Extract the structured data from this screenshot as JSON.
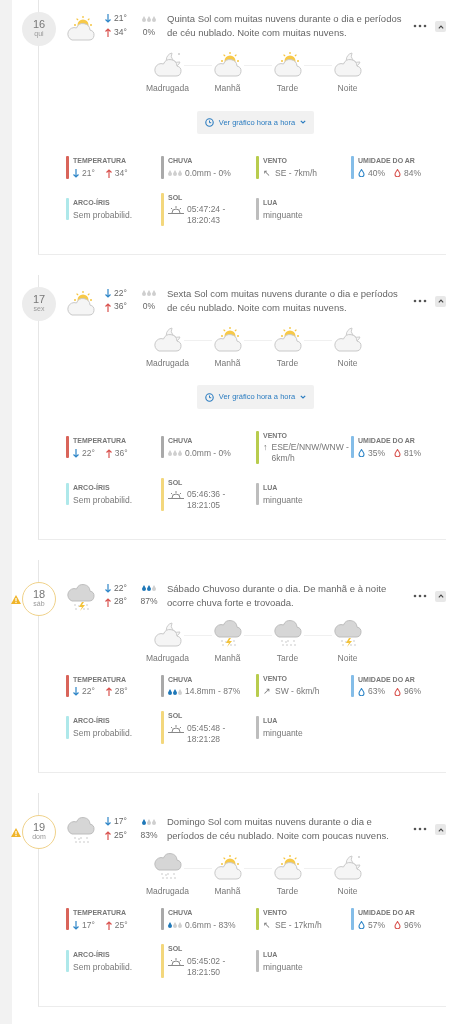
{
  "days": [
    {
      "alert": false,
      "day": "16",
      "weekday": "qui",
      "kind": "sun-cloud",
      "min": "21°",
      "max": "34°",
      "drops": [
        {
          "filled": false
        },
        {
          "filled": false
        },
        {
          "filled": false
        }
      ],
      "rain": "0%",
      "description": "Quinta Sol com muitas nuvens durante o dia e períodos de céu nublado. Noite com muitas nuvens.",
      "periods": [
        {
          "label": "Madrugada",
          "kind": "night-star"
        },
        {
          "label": "Manhã",
          "kind": "sun-cloud"
        },
        {
          "label": "Tarde",
          "kind": "sun-cloud"
        },
        {
          "label": "Noite",
          "kind": "night"
        }
      ],
      "graph_button": "Ver gráfico hora a hora",
      "stats": [
        {
          "kind": "temperature",
          "label": "TEMPERATURA",
          "color": "#d9645a",
          "min": "21°",
          "max": "34°"
        },
        {
          "kind": "rain",
          "label": "CHUVA",
          "color": "#a9a9a9",
          "drops": [
            {
              "filled": false
            },
            {
              "filled": false
            },
            {
              "filled": false
            }
          ],
          "value": "0.0mm - 0%"
        },
        {
          "kind": "wind",
          "label": "VENTO",
          "color": "#b8cc4e",
          "arrow": "↖",
          "value": "SE - 7km/h"
        },
        {
          "kind": "humidity",
          "label": "UMIDADE DO AR",
          "color": "#84bde8",
          "min": "40%",
          "max": "84%"
        },
        {
          "kind": "text",
          "label": "ARCO-ÍRIS",
          "color": "#aee8ea",
          "value": "Sem probabilid."
        },
        {
          "kind": "sun",
          "label": "SOL",
          "color": "#f3d77c",
          "value": "05:47:24 - 18:20:43"
        },
        {
          "kind": "text",
          "label": "LUA",
          "color": "#bdbdbd",
          "value": "minguante"
        }
      ]
    },
    {
      "alert": false,
      "day": "17",
      "weekday": "sex",
      "kind": "sun-cloud",
      "min": "22°",
      "max": "36°",
      "drops": [
        {
          "filled": false
        },
        {
          "filled": false
        },
        {
          "filled": false
        }
      ],
      "rain": "0%",
      "description": "Sexta Sol com muitas nuvens durante o dia e períodos de céu nublado. Noite com muitas nuvens.",
      "periods": [
        {
          "label": "Madrugada",
          "kind": "night"
        },
        {
          "label": "Manhã",
          "kind": "sun-cloud"
        },
        {
          "label": "Tarde",
          "kind": "sun-cloud"
        },
        {
          "label": "Noite",
          "kind": "night"
        }
      ],
      "graph_button": "Ver gráfico hora a hora",
      "stats": [
        {
          "kind": "temperature",
          "label": "TEMPERATURA",
          "color": "#d9645a",
          "min": "22°",
          "max": "36°"
        },
        {
          "kind": "rain",
          "label": "CHUVA",
          "color": "#a9a9a9",
          "drops": [
            {
              "filled": false
            },
            {
              "filled": false
            },
            {
              "filled": false
            }
          ],
          "value": "0.0mm - 0%"
        },
        {
          "kind": "wind",
          "label": "VENTO",
          "color": "#b8cc4e",
          "arrow": "↑",
          "value": "ESE/E/NNW/WNW - 6km/h"
        },
        {
          "kind": "humidity",
          "label": "UMIDADE DO AR",
          "color": "#84bde8",
          "min": "35%",
          "max": "81%"
        },
        {
          "kind": "text",
          "label": "ARCO-ÍRIS",
          "color": "#aee8ea",
          "value": "Sem probabilid."
        },
        {
          "kind": "sun",
          "label": "SOL",
          "color": "#f3d77c",
          "value": "05:46:36 - 18:21:05"
        },
        {
          "kind": "text",
          "label": "LUA",
          "color": "#bdbdbd",
          "value": "minguante"
        }
      ]
    },
    {
      "alert": true,
      "day": "18",
      "weekday": "sáb",
      "kind": "storm",
      "min": "22°",
      "max": "28°",
      "drops": [
        {
          "filled": true
        },
        {
          "filled": true
        },
        {
          "filled": false
        }
      ],
      "rain": "87%",
      "description": "Sábado Chuvoso durante o dia. De manhã e à noite ocorre chuva forte e trovoada.",
      "periods": [
        {
          "label": "Madrugada",
          "kind": "night"
        },
        {
          "label": "Manhã",
          "kind": "storm"
        },
        {
          "label": "Tarde",
          "kind": "rain"
        },
        {
          "label": "Noite",
          "kind": "storm"
        }
      ],
      "stats": [
        {
          "kind": "temperature",
          "label": "TEMPERATURA",
          "color": "#d9645a",
          "min": "22°",
          "max": "28°"
        },
        {
          "kind": "rain",
          "label": "CHUVA",
          "color": "#a9a9a9",
          "drops": [
            {
              "filled": true
            },
            {
              "filled": true
            },
            {
              "filled": false
            }
          ],
          "value": "14.8mm - 87%"
        },
        {
          "kind": "wind",
          "label": "VENTO",
          "color": "#b8cc4e",
          "arrow": "↗",
          "value": "SW - 6km/h"
        },
        {
          "kind": "humidity",
          "label": "UMIDADE DO AR",
          "color": "#84bde8",
          "min": "63%",
          "max": "96%"
        },
        {
          "kind": "text",
          "label": "ARCO-ÍRIS",
          "color": "#aee8ea",
          "value": "Sem probabilid."
        },
        {
          "kind": "sun",
          "label": "SOL",
          "color": "#f3d77c",
          "value": "05:45:48 - 18:21:28"
        },
        {
          "kind": "text",
          "label": "LUA",
          "color": "#bdbdbd",
          "value": "minguante"
        }
      ]
    },
    {
      "alert": true,
      "day": "19",
      "weekday": "dom",
      "kind": "rain",
      "min": "17°",
      "max": "25°",
      "drops": [
        {
          "filled": true
        },
        {
          "filled": false
        },
        {
          "filled": false
        }
      ],
      "rain": "83%",
      "description": "Domingo Sol com muitas nuvens durante o dia e períodos de céu nublado. Noite com poucas nuvens.",
      "periods": [
        {
          "label": "Madrugada",
          "kind": "rain"
        },
        {
          "label": "Manhã",
          "kind": "sun-cloud"
        },
        {
          "label": "Tarde",
          "kind": "sun-cloud"
        },
        {
          "label": "Noite",
          "kind": "night-star"
        }
      ],
      "stats": [
        {
          "kind": "temperature",
          "label": "TEMPERATURA",
          "color": "#d9645a",
          "min": "17°",
          "max": "25°"
        },
        {
          "kind": "rain",
          "label": "CHUVA",
          "color": "#a9a9a9",
          "drops": [
            {
              "filled": true
            },
            {
              "filled": false
            },
            {
              "filled": false
            }
          ],
          "value": "0.6mm - 83%"
        },
        {
          "kind": "wind",
          "label": "VENTO",
          "color": "#b8cc4e",
          "arrow": "↖",
          "value": "SE - 17km/h"
        },
        {
          "kind": "humidity",
          "label": "UMIDADE DO AR",
          "color": "#84bde8",
          "min": "57%",
          "max": "96%"
        },
        {
          "kind": "text",
          "label": "ARCO-ÍRIS",
          "color": "#aee8ea",
          "value": "Sem probabilid."
        },
        {
          "kind": "sun",
          "label": "SOL",
          "color": "#f3d77c",
          "value": "05:45:02 - 18:21:50"
        },
        {
          "kind": "text",
          "label": "LUA",
          "color": "#bdbdbd",
          "value": "minguante"
        }
      ]
    }
  ]
}
